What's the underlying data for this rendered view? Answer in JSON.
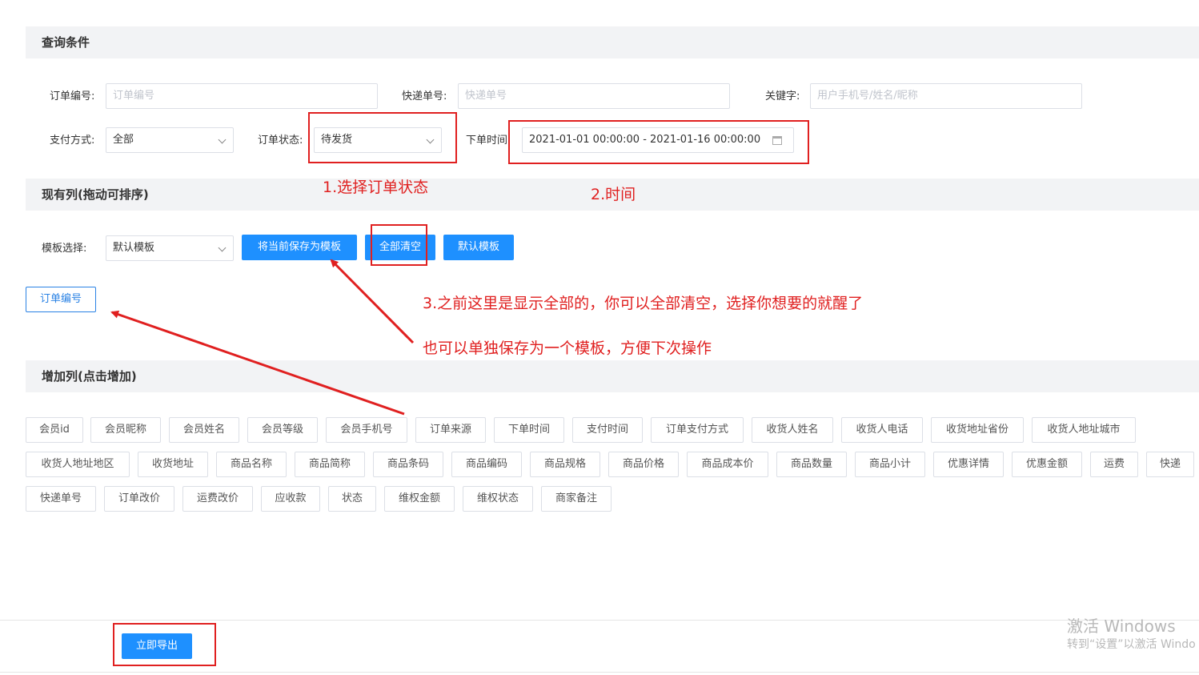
{
  "query": {
    "title": "查询条件",
    "order_no": {
      "label": "订单编号:",
      "placeholder": "订单编号"
    },
    "express_no": {
      "label": "快递单号:",
      "placeholder": "快递单号"
    },
    "keyword": {
      "label": "关键字:",
      "placeholder": "用户手机号/姓名/昵称"
    },
    "pay_method": {
      "label": "支付方式:",
      "value": "全部"
    },
    "order_status": {
      "label": "订单状态:",
      "value": "待发货"
    },
    "order_time": {
      "label": "下单时间:",
      "value": "2021-01-01 00:00:00 - 2021-01-16 00:00:00"
    }
  },
  "current_cols": {
    "title": "现有列(拖动可排序)",
    "template_label": "模板选择:",
    "template_value": "默认模板",
    "save_btn": "将当前保存为模板",
    "clear_btn": "全部清空",
    "default_btn": "默认模板",
    "columns": [
      "订单编号"
    ]
  },
  "add_cols": {
    "title": "增加列(点击增加)",
    "rows": [
      [
        "会员id",
        "会员昵称",
        "会员姓名",
        "会员等级",
        "会员手机号",
        "订单来源",
        "下单时间",
        "支付时间",
        "订单支付方式",
        "收货人姓名",
        "收货人电话",
        "收货地址省份",
        "收货人地址城市"
      ],
      [
        "收货人地址地区",
        "收货地址",
        "商品名称",
        "商品简称",
        "商品条码",
        "商品编码",
        "商品规格",
        "商品价格",
        "商品成本价",
        "商品数量",
        "商品小计",
        "优惠详情",
        "优惠金额",
        "运费",
        "快递"
      ],
      [
        "快递单号",
        "订单改价",
        "运费改价",
        "应收款",
        "状态",
        "维权金额",
        "维权状态",
        "商家备注"
      ]
    ]
  },
  "export_btn": "立即导出",
  "annotations": {
    "note1": "1.选择订单状态",
    "note2": "2.时间",
    "note3": "3.之前这里是显示全部的，你可以全部清空，选择你想要的就醒了",
    "note4": "也可以单独保存为一个模板，方便下次操作",
    "color": "#e02020"
  },
  "watermark": {
    "line1": "激活 Windows",
    "line2": "转到“设置”以激活 Windo"
  },
  "colors": {
    "primary": "#1e90ff",
    "section_bg": "#f2f3f5",
    "annotation": "#e02020"
  }
}
